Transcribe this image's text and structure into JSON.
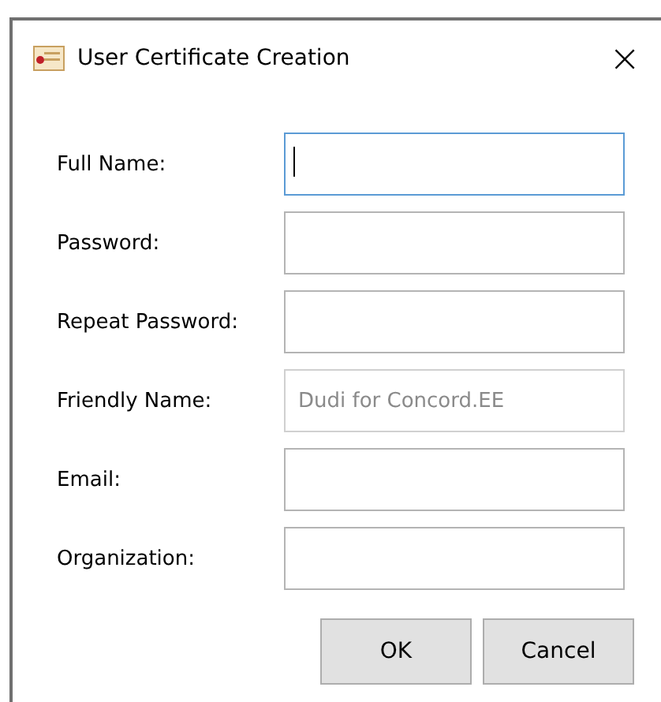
{
  "window": {
    "title": "User Certificate Creation",
    "close": "×"
  },
  "fields": [
    {
      "label": "Full Name:",
      "focused": true,
      "disabled": false
    },
    {
      "label": "Password:",
      "focused": false,
      "disabled": false
    },
    {
      "label": "Repeat Password:",
      "focused": false,
      "disabled": false
    },
    {
      "label": "Friendly Name:",
      "value": "Dudi for Concord.EE",
      "focused": false,
      "disabled": true
    },
    {
      "label": "Email:",
      "focused": false,
      "disabled": false
    },
    {
      "label": "Organization:",
      "focused": false,
      "disabled": false
    }
  ],
  "buttons": [
    "OK",
    "Cancel"
  ]
}
